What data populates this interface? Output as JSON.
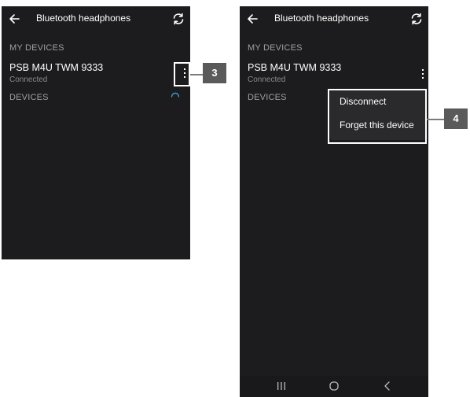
{
  "screen": {
    "title": "Bluetooth headphones",
    "section_my_devices": "MY DEVICES",
    "section_devices": "DEVICES",
    "device": {
      "name": "PSB M4U TWM  9333",
      "status": "Connected"
    }
  },
  "menu": {
    "items": [
      "Disconnect",
      "Forget this device"
    ]
  },
  "callouts": {
    "step3": "3",
    "step4": "4"
  },
  "colors": {
    "background": "#1c1c1e",
    "accent_spinner": "#3a9ad9",
    "badge": "#5a5a5a"
  }
}
